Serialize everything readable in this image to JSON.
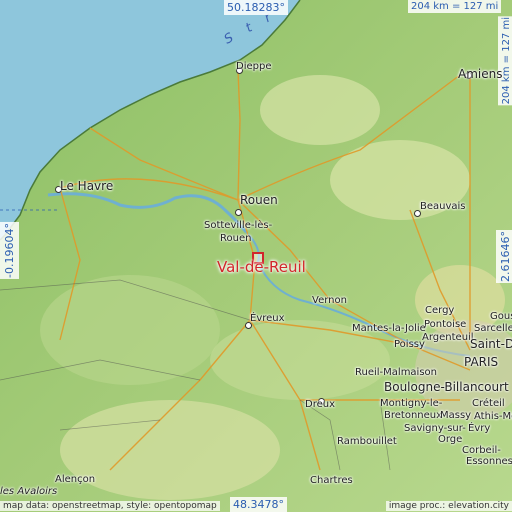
{
  "map": {
    "highlight": "Val-de-Reuil",
    "sea_label": "S t r",
    "coords": {
      "top": "50.18283°",
      "bottom": "48.3478°",
      "left": "-0.19604°",
      "right": "2.61646°"
    },
    "scale": {
      "horizontal": "204 km = 127 mi",
      "vertical": "204 km = 127 mi"
    },
    "places": [
      {
        "name": "Dieppe"
      },
      {
        "name": "Amiens"
      },
      {
        "name": "Le Havre"
      },
      {
        "name": "Rouen"
      },
      {
        "name": "Sotteville-lès-"
      },
      {
        "name": "Rouen"
      },
      {
        "name": "Beauvais"
      },
      {
        "name": "Vernon"
      },
      {
        "name": "Évreux"
      },
      {
        "name": "Cergy"
      },
      {
        "name": "Gous"
      },
      {
        "name": "Sarcelles"
      },
      {
        "name": "Pontoise"
      },
      {
        "name": "Mantes-la-Jolie"
      },
      {
        "name": "Argenteuil"
      },
      {
        "name": "Poissy"
      },
      {
        "name": "Saint-D"
      },
      {
        "name": "PARIS"
      },
      {
        "name": "Rueil-Malmaison"
      },
      {
        "name": "Boulogne-Billancourt"
      },
      {
        "name": "Dreux"
      },
      {
        "name": "Montigny-le-"
      },
      {
        "name": "Bretonneux"
      },
      {
        "name": "Massy"
      },
      {
        "name": "Créteil"
      },
      {
        "name": "Évry"
      },
      {
        "name": "Athis-Mons"
      },
      {
        "name": "Savigny-sur-"
      },
      {
        "name": "Orge"
      },
      {
        "name": "Corbeil-"
      },
      {
        "name": "Essonnes"
      },
      {
        "name": "Rambouillet"
      },
      {
        "name": "Chartres"
      },
      {
        "name": "Alençon"
      },
      {
        "name": "les Avaloirs"
      }
    ],
    "credits": {
      "left": "map data: openstreetmap, style: opentopomap",
      "right": "image proc.: elevation.city"
    },
    "colors": {
      "sea": "#8ec6dc",
      "lowland": "#7ab55a",
      "midland": "#b5d48a",
      "highland": "#e6dfa3",
      "road": "#e09a2a",
      "highlight": "#d2262b",
      "coord_text": "#2a5db0"
    }
  }
}
